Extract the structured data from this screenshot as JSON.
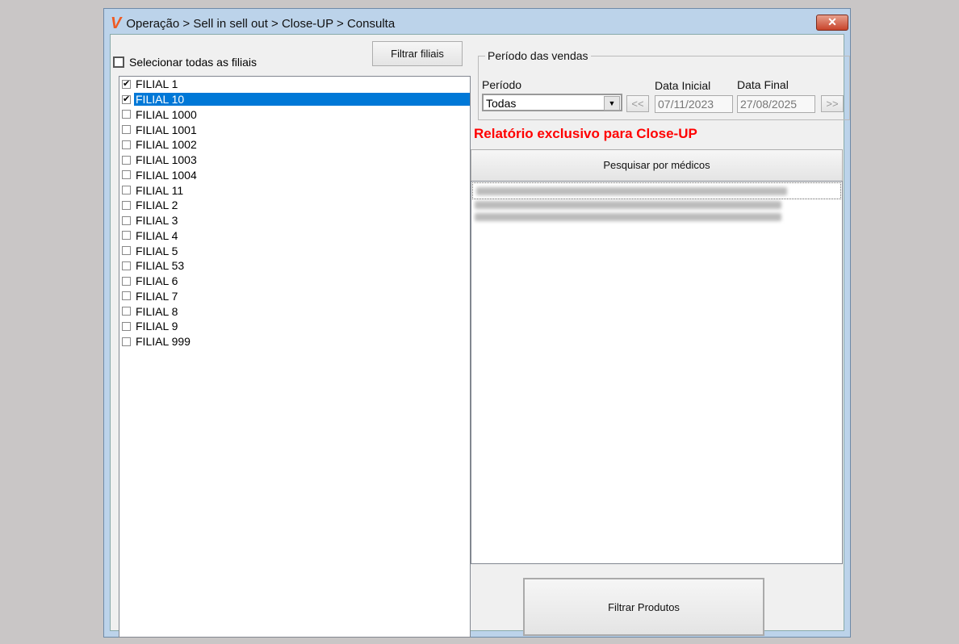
{
  "window": {
    "title": "Operação > Sell in sell out > Close-UP > Consulta",
    "close_label": "✕",
    "logo": "V"
  },
  "left": {
    "select_all_label": "Selecionar todas as filiais",
    "filter_button": "Filtrar filiais",
    "branches": [
      {
        "label": "FILIAL 1",
        "checked": true
      },
      {
        "label": "FILIAL 10",
        "checked": true,
        "selected": true
      },
      {
        "label": "FILIAL 1000"
      },
      {
        "label": "FILIAL 1001"
      },
      {
        "label": "FILIAL 1002"
      },
      {
        "label": "FILIAL 1003"
      },
      {
        "label": "FILIAL 1004"
      },
      {
        "label": "FILIAL 11"
      },
      {
        "label": "FILIAL 2"
      },
      {
        "label": "FILIAL 3"
      },
      {
        "label": "FILIAL 4"
      },
      {
        "label": "FILIAL 5"
      },
      {
        "label": "FILIAL 53"
      },
      {
        "label": "FILIAL 6"
      },
      {
        "label": "FILIAL 7"
      },
      {
        "label": "FILIAL 8"
      },
      {
        "label": "FILIAL 9"
      },
      {
        "label": "FILIAL 999"
      }
    ]
  },
  "period": {
    "group_label": "Período das vendas",
    "period_label": "Período",
    "period_value": "Todas",
    "start_label": "Data Inicial",
    "start_value": "07/11/2023",
    "end_label": "Data Final",
    "end_value": "27/08/2025",
    "prev_label": "<<",
    "next_label": ">>"
  },
  "notice": "Relatório exclusivo para Close-UP",
  "notice_color": "#ff0000",
  "doctor_button": "Pesquisar por médicos",
  "products_button": "Filtrar Produtos"
}
